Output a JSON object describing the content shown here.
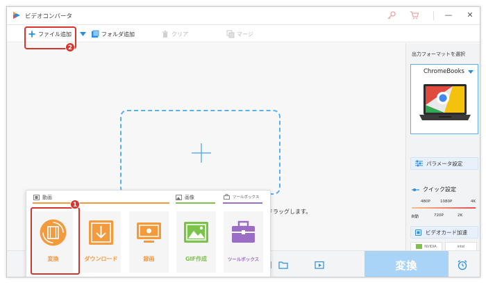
{
  "window": {
    "title": "ビデオコンバータ",
    "controls": [
      "—",
      "□",
      "✕"
    ]
  },
  "toolbar": {
    "add_file": "ファイル追加",
    "add_folder": "フォルダ追加",
    "clear": "クリア",
    "merge": "マージ"
  },
  "badges": {
    "step1": "1",
    "step2": "2"
  },
  "main": {
    "drop_hint": "でドラッグします。"
  },
  "right_panel": {
    "output_format_title": "出力フォーマットを選択",
    "format_name": "ChromeBooks",
    "param_button": "パラメータ設定",
    "quick_setting_title": "クイック設定",
    "quick_top_labels": [
      "480P",
      "1080P",
      "4K"
    ],
    "quick_bottom_labels": [
      "自動",
      "720P",
      "2K"
    ],
    "gpu_button": "ビデオカード加速",
    "gpu_vendors": [
      "NVIDIA",
      "intel"
    ]
  },
  "bottom": {
    "convert_button": "変換"
  },
  "popup": {
    "categories": [
      "動画",
      "画像",
      "ツールボックス"
    ],
    "tiles": [
      "変換",
      "ダウンロード",
      "録画",
      "GIF作成",
      "ツールボックス"
    ]
  },
  "colors": {
    "accent_blue": "#2a8ee0",
    "highlight_red": "#d9342b",
    "orange": "#f39a3c",
    "green": "#7dc24b",
    "purple": "#9b6dc6",
    "convert_disabled": "#a9d4f7"
  }
}
